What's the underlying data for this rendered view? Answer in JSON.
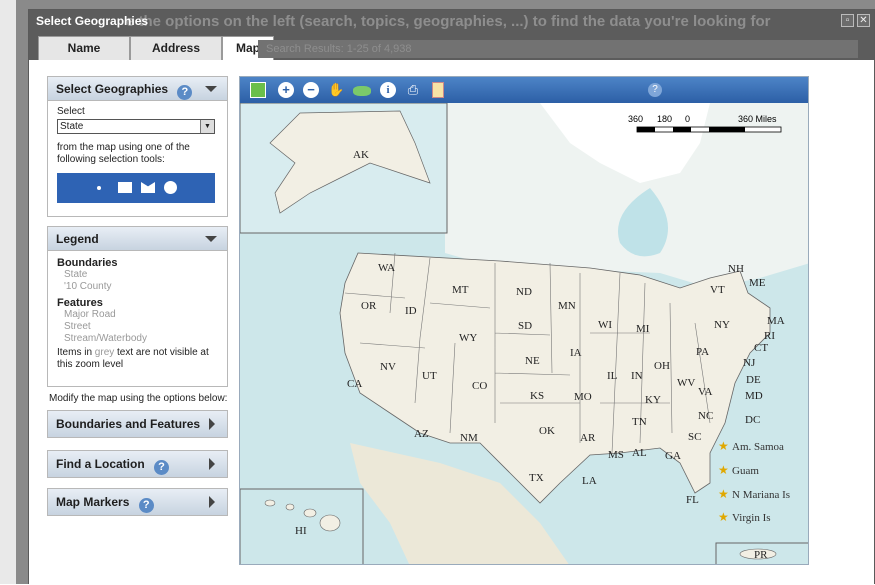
{
  "dialog": {
    "title": "Select Geographies",
    "background_hint": "e the options on the left (search, topics, geographies, ...) to find the data you're looking for",
    "window_buttons": [
      "restore-icon",
      "close-icon"
    ]
  },
  "tabs": [
    {
      "label": "Name",
      "active": false
    },
    {
      "label": "Address",
      "active": false
    },
    {
      "label": "Map",
      "active": true
    }
  ],
  "search_results": "Search Results:  1-25  of  4,938",
  "select_geo": {
    "header": "Select Geographies",
    "select_label": "Select",
    "selected": "State",
    "instructions": "from the map using one of the following selection tools:",
    "tools": [
      "point-tool-icon",
      "rectangle-tool-icon",
      "polygon-tool-icon",
      "circle-tool-icon"
    ]
  },
  "legend": {
    "header": "Legend",
    "boundaries_title": "Boundaries",
    "boundaries": [
      "State",
      "'10 County"
    ],
    "features_title": "Features",
    "features": [
      "Major Road",
      "Street",
      "Stream/Waterbody"
    ],
    "note_before": "Items in ",
    "note_grey": "grey",
    "note_after": " text are not visible at this zoom level"
  },
  "modify_text": "Modify the map using the options below:",
  "panels": {
    "boundaries": "Boundaries and Features",
    "find": "Find a Location",
    "markers": "Map Markers"
  },
  "map": {
    "help": "?",
    "scale_labels": [
      "360",
      "180",
      "0",
      "360 Miles"
    ],
    "states": [
      "WA",
      "OR",
      "ID",
      "MT",
      "ND",
      "MN",
      "SD",
      "WY",
      "NV",
      "UT",
      "CO",
      "CA",
      "AZ",
      "NM",
      "NE",
      "KS",
      "OK",
      "TX",
      "IA",
      "MO",
      "AR",
      "LA",
      "WI",
      "MI",
      "IL",
      "IN",
      "OH",
      "KY",
      "TN",
      "MS",
      "AL",
      "GA",
      "FL",
      "SC",
      "NC",
      "VA",
      "WV",
      "PA",
      "NY",
      "VT",
      "NH",
      "ME",
      "MA",
      "RI",
      "CT",
      "NJ",
      "DE",
      "MD",
      "DC",
      "AK",
      "HI",
      "PR"
    ],
    "territories": [
      "Am. Samoa",
      "Guam",
      "N Mariana Is",
      "Virgin Is"
    ]
  },
  "colors": {
    "toolbar": "#2c5fa6",
    "titlebar": "#5c5c5c",
    "land": "#f2efe4",
    "water": "#cde7ea"
  }
}
